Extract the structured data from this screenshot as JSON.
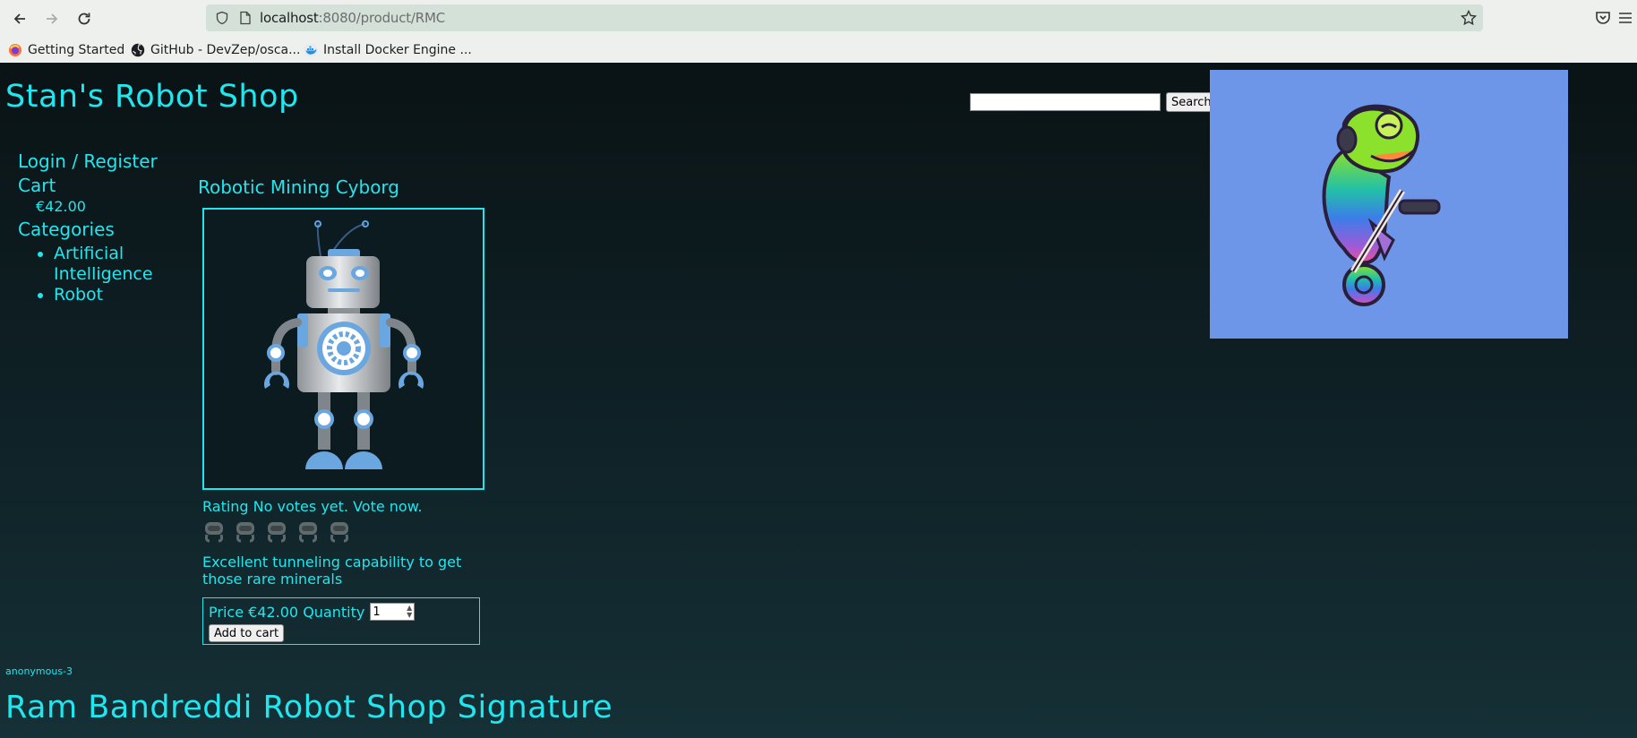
{
  "browser": {
    "url_host": "localhost",
    "url_rest": ":8080/product/RMC",
    "bookmarks": [
      {
        "label": "Getting Started",
        "icon": "firefox-icon"
      },
      {
        "label": "GitHub - DevZep/osca...",
        "icon": "github-icon"
      },
      {
        "label": "Install Docker Engine ...",
        "icon": "docker-icon"
      }
    ]
  },
  "site": {
    "title": "Stan's Robot Shop",
    "search_button": "Search",
    "search_value": ""
  },
  "sidebar": {
    "login": "Login / Register",
    "cart": "Cart",
    "cart_total": "€42.00",
    "categories": "Categories",
    "category_items": [
      "Artificial Intelligence",
      "Robot"
    ]
  },
  "product": {
    "name": "Robotic Mining Cyborg",
    "rating_text": "Rating No votes yet. Vote now.",
    "vote_count": 5,
    "description": "Excellent tunneling capability to get those rare minerals",
    "price_text": "Price €42.00 Quantity",
    "quantity": "1",
    "add_button": "Add to cart"
  },
  "footer": {
    "user": "anonymous-3",
    "signature": "Ram Bandreddi Robot Shop Signature"
  },
  "colors": {
    "accent": "#22e6ee",
    "hero_bg": "#6d95e8"
  }
}
